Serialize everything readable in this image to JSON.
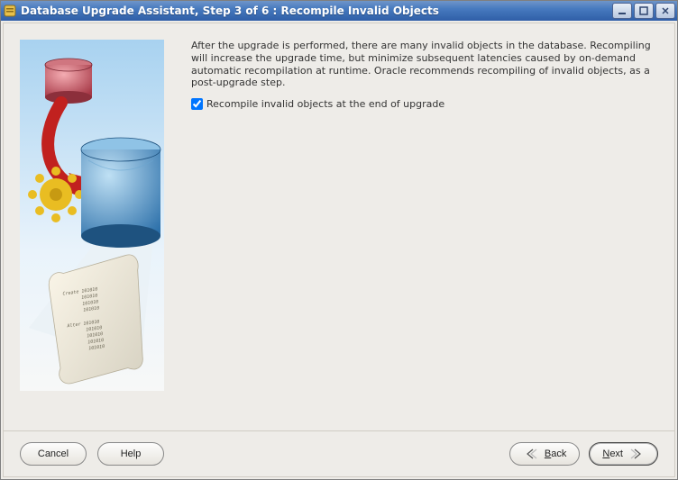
{
  "titlebar": {
    "title": "Database Upgrade Assistant, Step 3 of 6 : Recompile Invalid Objects"
  },
  "main": {
    "paragraph": "After the upgrade is performed, there are many invalid objects in the database. Recompiling will increase the upgrade time, but minimize subsequent latencies caused by on-demand automatic recompilation at runtime. Oracle recommends recompiling of invalid objects, as a post-upgrade step.",
    "checkbox_label": "Recompile invalid objects at the end of upgrade",
    "checkbox_checked": true
  },
  "footer": {
    "cancel": "Cancel",
    "help": "Help",
    "back": "Back",
    "next": "Next"
  }
}
